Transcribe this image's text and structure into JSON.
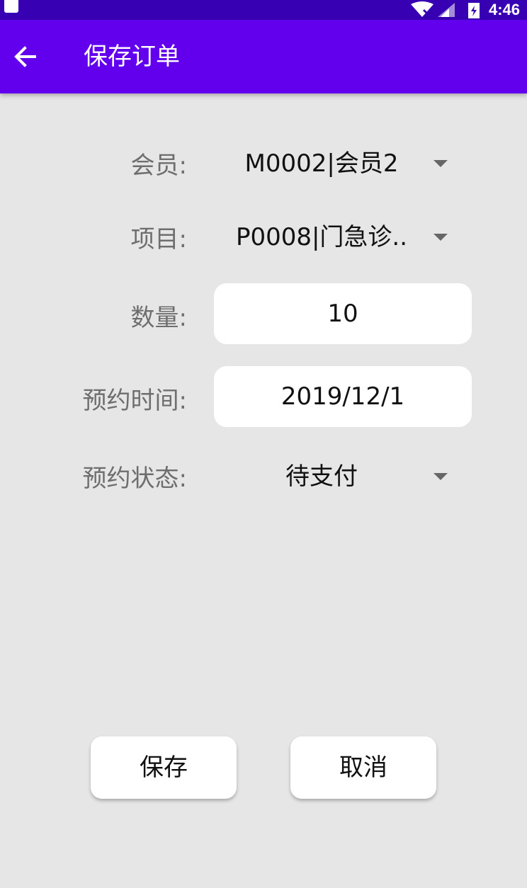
{
  "status_bar": {
    "time": "4:46",
    "icons": [
      "sd-card-icon",
      "wifi-off-icon",
      "signal-icon",
      "battery-charging-icon"
    ]
  },
  "app_bar": {
    "back_icon": "arrow-left-icon",
    "title": "保存订单"
  },
  "form": {
    "member": {
      "label": "会员:",
      "value": "M0002|会员2"
    },
    "project": {
      "label": "项目:",
      "value": "P0008|门急诊.."
    },
    "quantity": {
      "label": "数量:",
      "value": "10"
    },
    "appointment_time": {
      "label": "预约时间:",
      "value": "2019/12/1"
    },
    "appointment_status": {
      "label": "预约状态:",
      "value": "待支付"
    }
  },
  "buttons": {
    "save": "保存",
    "cancel": "取消"
  },
  "colors": {
    "status_bar": "#3700b3",
    "app_bar": "#6200ee",
    "background": "#e6e6e6"
  }
}
